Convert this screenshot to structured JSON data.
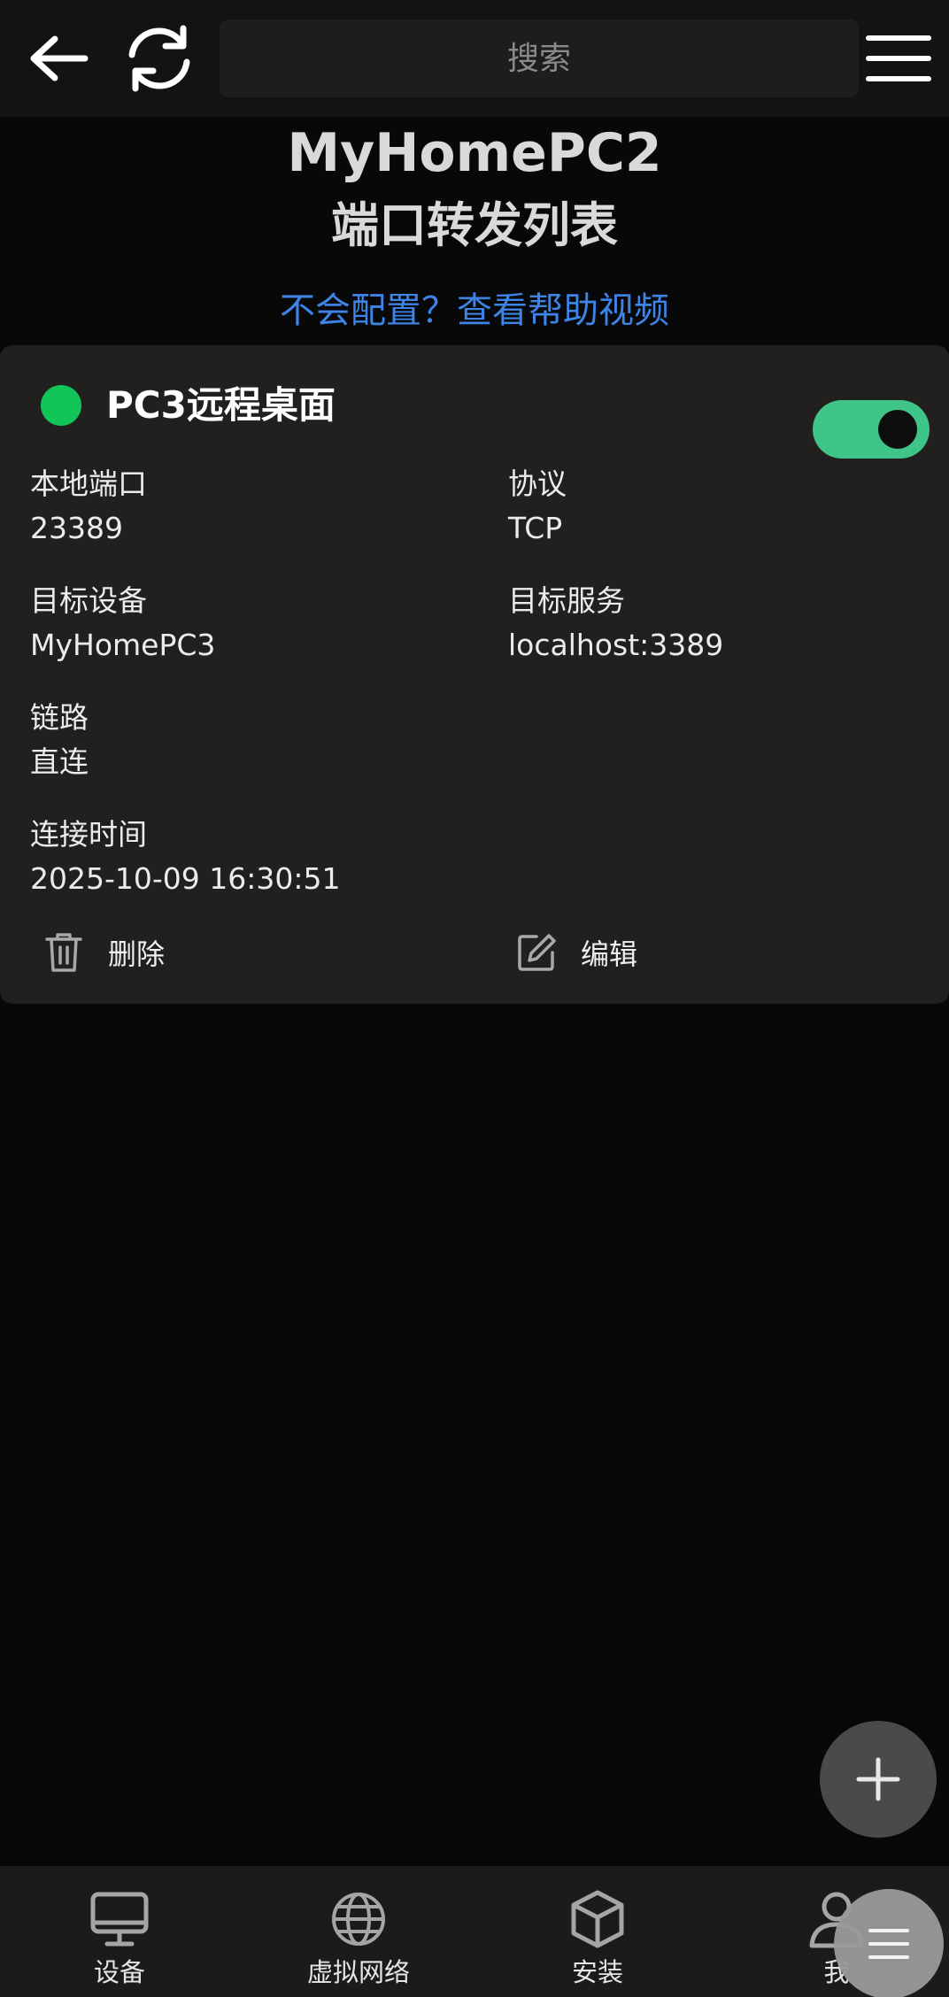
{
  "header": {
    "search_placeholder": "搜索",
    "back_icon": "back-arrow-icon",
    "refresh_icon": "refresh-icon",
    "menu_icon": "hamburger-menu-icon"
  },
  "page": {
    "device_name": "MyHomePC2",
    "list_title": "端口转发列表",
    "help_link": "不会配置？查看帮助视频"
  },
  "rule": {
    "name": "PC3远程桌面",
    "status_color": "#11c559",
    "enabled": true,
    "fields": {
      "local_port_label": "本地端口",
      "local_port_value": "23389",
      "protocol_label": "协议",
      "protocol_value": "TCP",
      "target_device_label": "目标设备",
      "target_device_value": "MyHomePC3",
      "target_service_label": "目标服务",
      "target_service_value": "localhost:3389",
      "link_label": "链路",
      "link_value": "直连",
      "connect_time_label": "连接时间",
      "connect_time_value": "2025-10-09 16:30:51"
    },
    "actions": {
      "delete_label": "删除",
      "edit_label": "编辑"
    }
  },
  "bottom_nav": {
    "items": [
      {
        "label": "设备",
        "icon": "monitor-icon"
      },
      {
        "label": "虚拟网络",
        "icon": "globe-icon"
      },
      {
        "label": "安装",
        "icon": "package-cube-icon"
      },
      {
        "label": "我",
        "icon": "user-icon"
      }
    ]
  },
  "colors": {
    "accent_link": "#3d84e6",
    "toggle_on": "#3fc587",
    "background": "#080808",
    "card": "#221f1f"
  }
}
